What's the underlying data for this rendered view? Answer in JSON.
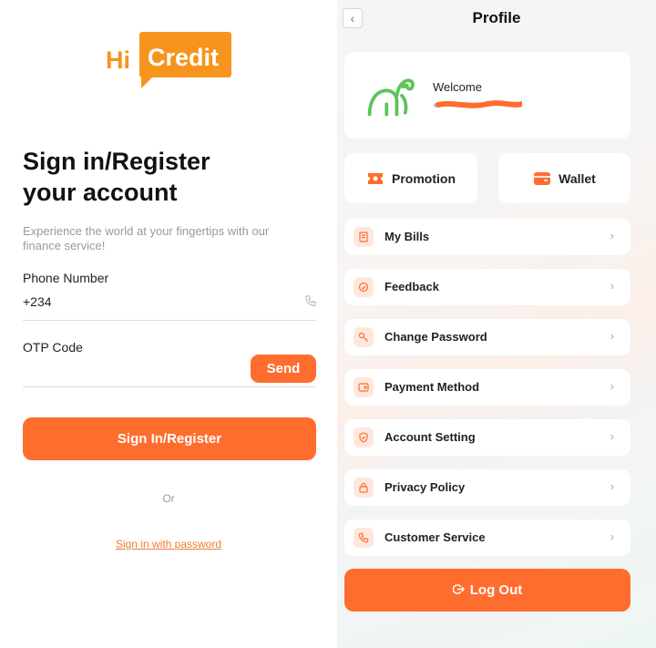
{
  "login": {
    "logo_hi": "Hi",
    "logo_credit": "Credit",
    "title_line1": "Sign in/Register",
    "title_line2": "your account",
    "subtitle": "Experience the world at your fingertips with our finance service!",
    "phone_label": "Phone Number",
    "phone_prefix": "+234",
    "otp_label": "OTP Code",
    "send_label": "Send",
    "signin_label": "Sign In/Register",
    "or_label": "Or",
    "password_link": "Sign in with password"
  },
  "profile": {
    "back_icon": "chevron-left-icon",
    "title": "Profile",
    "welcome": "Welcome",
    "quick_actions": [
      {
        "label": "Promotion",
        "icon": "ticket-icon"
      },
      {
        "label": "Wallet",
        "icon": "wallet-icon"
      }
    ],
    "menu": [
      {
        "label": "My Bills",
        "icon": "bill-icon"
      },
      {
        "label": "Feedback",
        "icon": "feedback-icon"
      },
      {
        "label": "Change Password",
        "icon": "key-icon"
      },
      {
        "label": "Payment Method",
        "icon": "card-icon"
      },
      {
        "label": "Account Setting",
        "icon": "shield-icon"
      },
      {
        "label": "Privacy Policy",
        "icon": "lock-icon"
      },
      {
        "label": "Customer Service",
        "icon": "phone-icon"
      }
    ],
    "logout_label": "Log Out"
  },
  "colors": {
    "accent": "#ff6d2e",
    "logo": "#f7941d",
    "elephant": "#5cc45a",
    "icon_bg": "#fde8dd"
  }
}
